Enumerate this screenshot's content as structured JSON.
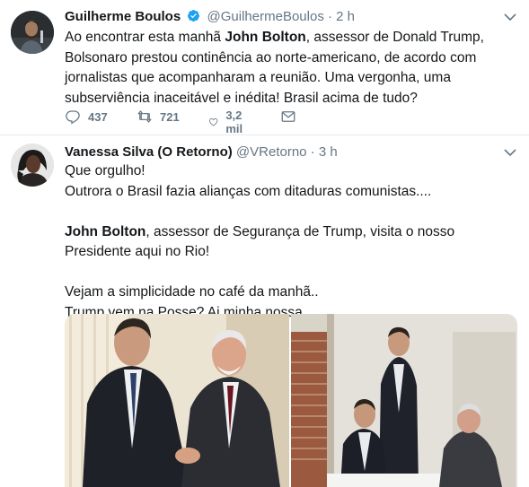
{
  "tweets": [
    {
      "name": "Guilherme Boulos",
      "handle": "@GuilhermeBoulos",
      "separator": "·",
      "time": "2 h",
      "verified": true,
      "paragraphs": [
        [
          {
            "t": "Ao encontrar esta manhã "
          },
          {
            "t": "John Bolton",
            "b": true
          },
          {
            "t": ", assessor de Donald Trump, Bolsonaro prestou continência ao norte-americano, de acordo com jornalistas que acompanharam a reunião. Uma vergonha, uma subserviência inaceitável e inédita! Brasil acima de tudo?"
          }
        ]
      ],
      "actions": {
        "reply_count": "437",
        "retweet_count": "721",
        "like_count": "3,2 mil"
      }
    },
    {
      "name": "Vanessa Silva (O Retorno)",
      "handle": "@VRetorno",
      "separator": "·",
      "time": "3 h",
      "verified": false,
      "paragraphs": [
        [
          {
            "t": "Que orgulho!"
          }
        ],
        [
          {
            "t": "Outrora o Brasil fazia alianças com ditaduras comunistas...."
          }
        ],
        [],
        [
          {
            "t": "John Bolton",
            "b": true
          },
          {
            "t": ", assessor de Segurança de Trump, visita o nosso Presidente aqui no Rio!"
          }
        ],
        [],
        [
          {
            "t": "Vejam a simplicidade no café da manhã.."
          }
        ],
        [
          {
            "t": "Trump vem na Posse? Ai minha nossa..."
          }
        ]
      ]
    }
  ],
  "icons": {
    "verified": "verified-badge-icon",
    "caret": "chevron-down-icon",
    "reply": "reply-icon",
    "retweet": "retweet-icon",
    "like": "heart-icon",
    "message": "envelope-icon"
  },
  "colors": {
    "text": "#14171a",
    "secondary": "#657786",
    "verified": "#1da1f2",
    "divider": "#e6ecf0"
  }
}
